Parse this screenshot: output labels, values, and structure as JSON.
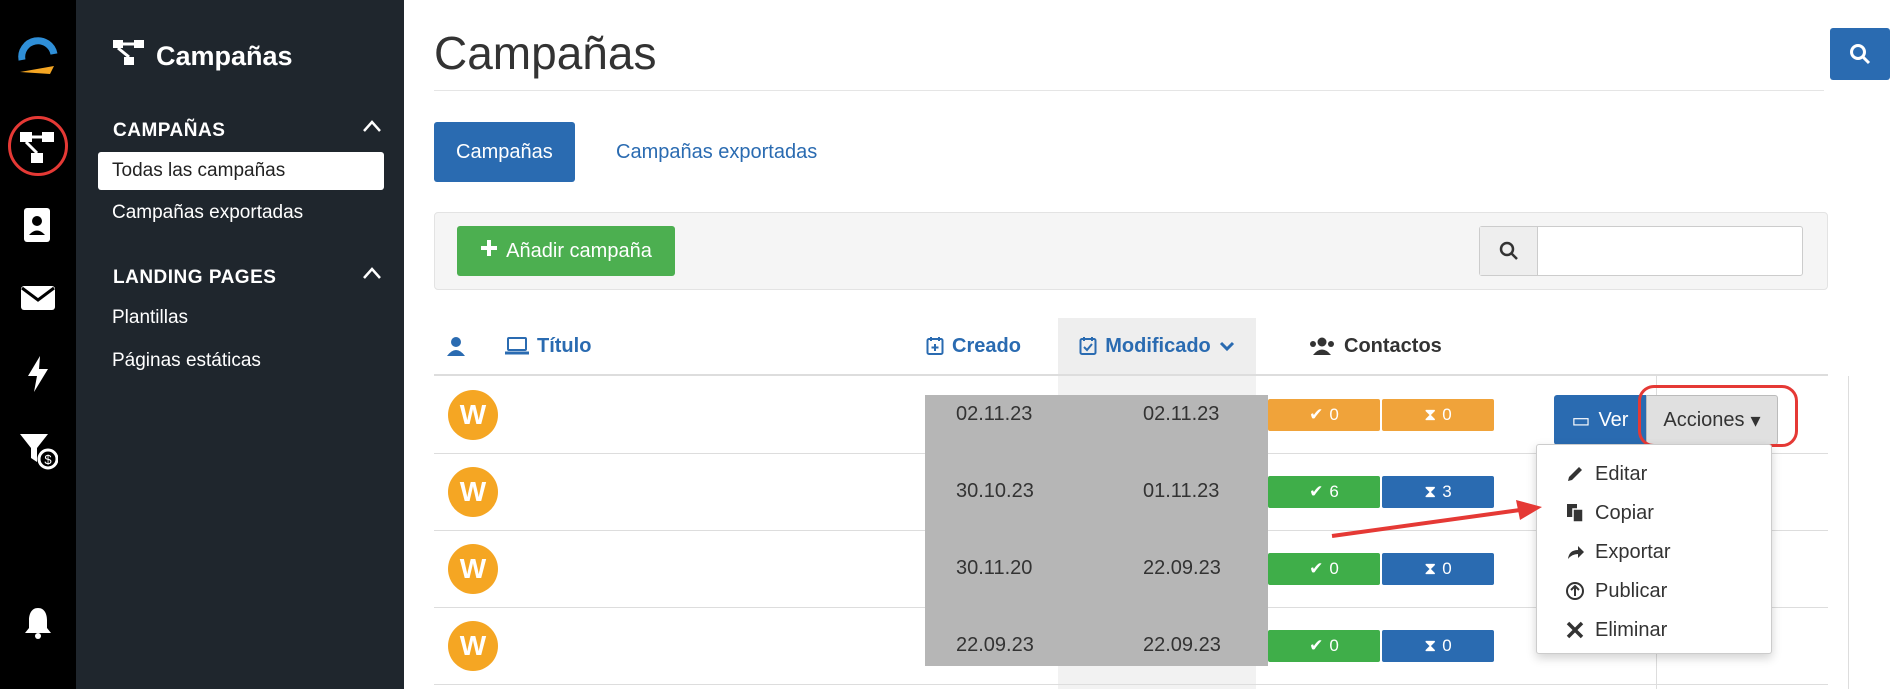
{
  "rail": {
    "icons": [
      "logo-icon",
      "campaigns-icon",
      "contacts-icon",
      "mail-icon",
      "bolt-icon",
      "funnel-money-icon",
      "bell-icon"
    ]
  },
  "nav": {
    "brand": "Campañas",
    "sections": [
      {
        "title": "CAMPAÑAS",
        "items": [
          "Todas las campañas",
          "Campañas exportadas"
        ]
      },
      {
        "title": "LANDING PAGES",
        "items": [
          "Plantillas",
          "Páginas estáticas"
        ]
      }
    ]
  },
  "page": {
    "title": "Campañas",
    "tabs": [
      "Campañas",
      "Campañas exportadas"
    ],
    "add_button": "Añadir campaña",
    "search_placeholder": ""
  },
  "table": {
    "headers": {
      "title": "Título",
      "created": "Creado",
      "modified": "Modificado",
      "contacts": "Contactos"
    },
    "rows": [
      {
        "avatar": "W",
        "created": "02.11.23",
        "modified": "02.11.23",
        "done": "0",
        "pending": "0",
        "pending_color": "#f0a33a",
        "done_color": "#f0a33a"
      },
      {
        "avatar": "W",
        "created": "30.10.23",
        "modified": "01.11.23",
        "done": "6",
        "pending": "3",
        "pending_color": "#2a6bb1",
        "done_color": "#3fae49"
      },
      {
        "avatar": "W",
        "created": "30.11.20",
        "modified": "22.09.23",
        "done": "0",
        "pending": "0",
        "pending_color": "#2a6bb1",
        "done_color": "#3fae49"
      },
      {
        "avatar": "W",
        "created": "22.09.23",
        "modified": "22.09.23",
        "done": "0",
        "pending": "0",
        "pending_color": "#2a6bb1",
        "done_color": "#3fae49"
      }
    ],
    "view_label": "Ver",
    "actions_label": "Acciones"
  },
  "actions_menu": {
    "items": [
      "Editar",
      "Copiar",
      "Exportar",
      "Publicar",
      "Eliminar"
    ]
  },
  "colors": {
    "primary": "#2a6bb1",
    "success": "#4caf50",
    "warning": "#f0a33a",
    "annotation": "#e53935"
  }
}
